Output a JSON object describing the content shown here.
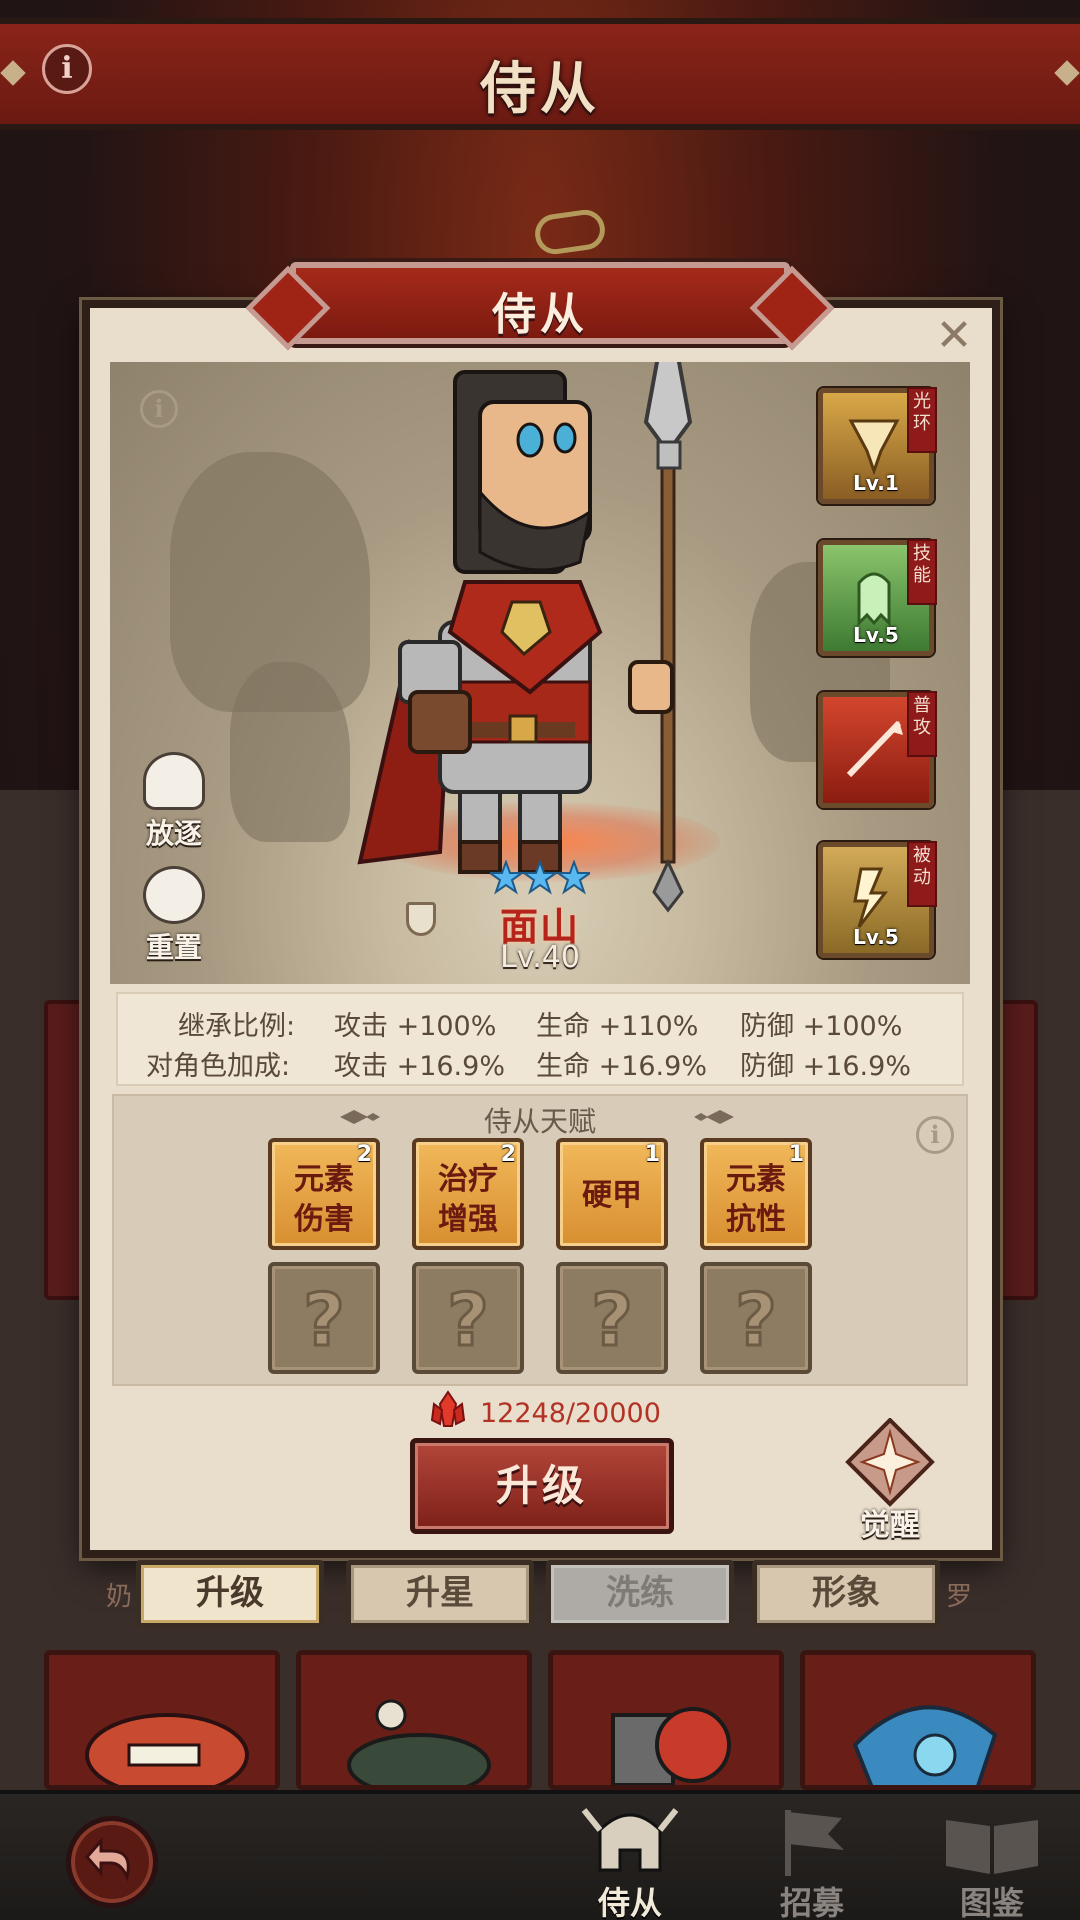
{
  "header": {
    "title": "侍从",
    "info_icon": "info-icon"
  },
  "modal": {
    "title": "侍从",
    "close_icon": "close-icon",
    "scene_info_icon": "info-icon",
    "side_actions": [
      {
        "label": "放逐",
        "icon": "horse-head-icon"
      },
      {
        "label": "重置",
        "icon": "refresh-icon"
      }
    ],
    "skills": [
      {
        "tag": "光环",
        "level": "Lv.1",
        "icon": "aura-skill-icon",
        "color": "#b8863a"
      },
      {
        "tag": "技能",
        "level": "Lv.5",
        "icon": "ghost-skill-icon",
        "color": "#5a9a48"
      },
      {
        "tag": "普攻",
        "level": "",
        "icon": "spear-attack-icon",
        "color": "#b2321e"
      },
      {
        "tag": "被动",
        "level": "Lv.5",
        "icon": "lightning-sword-icon",
        "color": "#a8842e"
      }
    ],
    "hero": {
      "name": "面山",
      "level": "Lv.40",
      "stars": 3,
      "star_color": "#5ab8f0"
    },
    "stats": {
      "inherit_label": "继承比例:",
      "inherit": [
        "攻击 +100%",
        "生命 +110%",
        "防御 +100%"
      ],
      "bonus_label": "对角色加成:",
      "bonus": [
        "攻击 +16.9%",
        "生命 +16.9%",
        "防御 +16.9%"
      ]
    },
    "talents": {
      "title": "侍从天赋",
      "unlocked": [
        {
          "name": "元素\n伤害",
          "count": "2"
        },
        {
          "name": "治疗\n增强",
          "count": "2"
        },
        {
          "name": "硬甲",
          "count": "1"
        },
        {
          "name": "元素\n抗性",
          "count": "1"
        }
      ],
      "locked_symbol": "?"
    },
    "cost": {
      "value": "12248/20000",
      "icon": "red-crystal-icon"
    },
    "upgrade_label": "升级",
    "awaken_label": "觉醒"
  },
  "tabs": [
    {
      "label": "升级",
      "state": "active"
    },
    {
      "label": "升星",
      "state": "normal"
    },
    {
      "label": "洗练",
      "state": "disabled"
    },
    {
      "label": "形象",
      "state": "normal"
    }
  ],
  "bg_side_names": {
    "left": "奶",
    "right": "罗"
  },
  "bottom_nav": {
    "back_icon": "back-arrow-icon",
    "items": [
      {
        "label": "侍从",
        "icon": "helmet-icon",
        "active": true
      },
      {
        "label": "招募",
        "icon": "flag-icon",
        "active": false
      },
      {
        "label": "图鉴",
        "icon": "book-icon",
        "active": false
      }
    ]
  }
}
